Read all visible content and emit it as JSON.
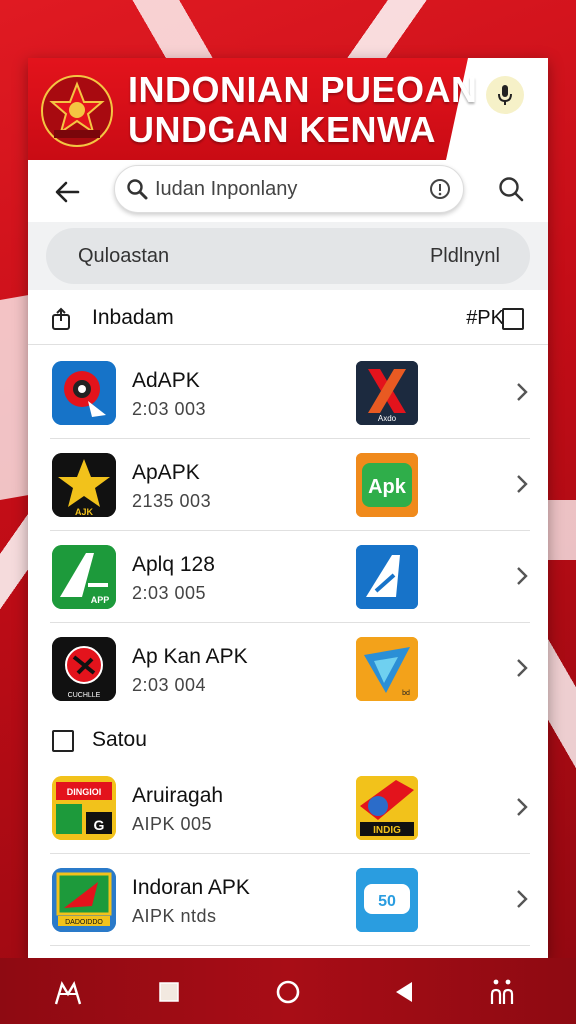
{
  "banner": {
    "line1": "INDONIAN PUEOAN",
    "line2": "UNDGAN KENWA"
  },
  "search": {
    "query": "Iudan Inponlany"
  },
  "filter": {
    "left": "Quloastan",
    "right": "Pldlnynl"
  },
  "section1": {
    "label": "Inbadam",
    "right": "#PK"
  },
  "apps1": [
    {
      "name": "AdAPK",
      "sub": "2:03 003"
    },
    {
      "name": "ApAPK",
      "sub": "2135 003"
    },
    {
      "name": "Aplq 128",
      "sub": "2:03 005"
    },
    {
      "name": "Ap Kan APK",
      "sub": "2:03 004"
    }
  ],
  "section2": {
    "label": "Satou"
  },
  "apps2": [
    {
      "name": "Aruiragah",
      "sub": "AIPK 005"
    },
    {
      "name": "Indoran APK",
      "sub": "AIPK ntds"
    }
  ],
  "icon_text": {
    "r1": "Axdo",
    "l2": "AJK",
    "r2": "Apk",
    "l3": "APP",
    "l4": "CUCHLLE",
    "l5a": "DINGIOI",
    "l5b": "G",
    "r5": "INDIG",
    "r4": "bd",
    "l6": "DADOIDDO",
    "r6": "50"
  },
  "icons": {
    "mic": "microphone-icon",
    "back": "arrow-left-icon",
    "search": "search-icon",
    "info": "info-icon",
    "share": "share-icon",
    "checkbox": "checkbox-icon",
    "chevron": "chevron-right-icon"
  },
  "colors": {
    "brand_red": "#d7131c",
    "nav_red": "#9b0b14"
  }
}
